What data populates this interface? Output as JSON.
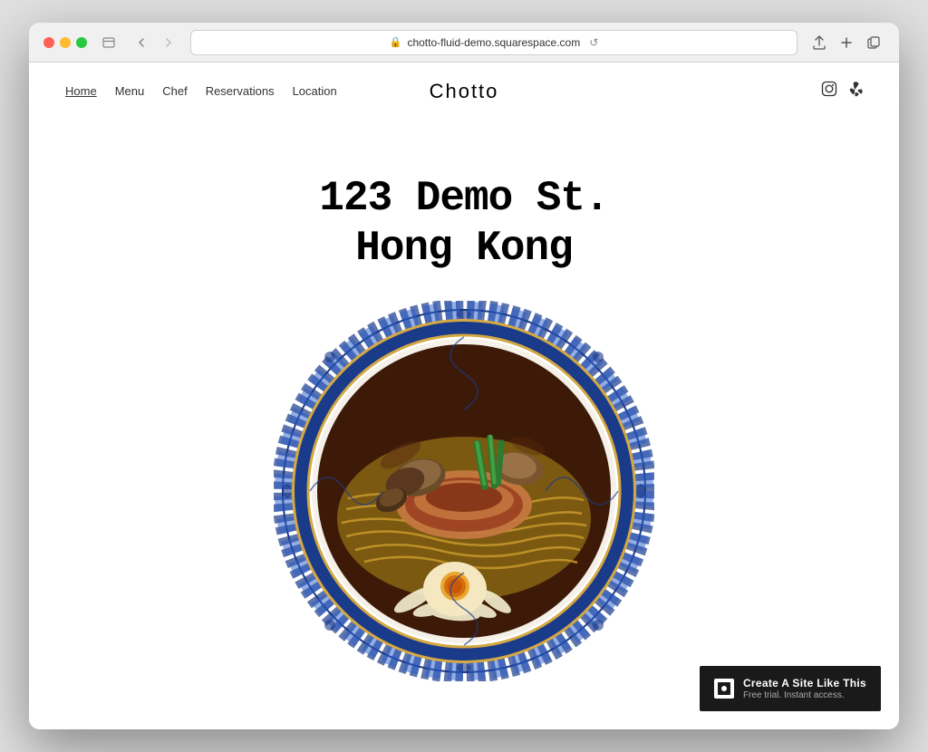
{
  "browser": {
    "url": "chotto-fluid-demo.squarespace.com",
    "back_label": "‹",
    "forward_label": "›",
    "refresh_label": "↺",
    "share_label": "⬆",
    "new_tab_label": "+",
    "duplicate_label": "⧉",
    "window_toggle_label": "❐"
  },
  "site": {
    "title": "Chotto",
    "nav": [
      {
        "label": "Home",
        "active": true
      },
      {
        "label": "Menu",
        "active": false
      },
      {
        "label": "Chef",
        "active": false
      },
      {
        "label": "Reservations",
        "active": false
      },
      {
        "label": "Location",
        "active": false
      }
    ],
    "social": [
      {
        "name": "instagram-icon",
        "glyph": "⬡"
      },
      {
        "name": "yelp-icon",
        "glyph": "❋"
      }
    ],
    "hero": {
      "line1": "123 Demo St.",
      "line2": "Hong Kong"
    },
    "banner": {
      "main_text": "Create A Site Like This",
      "sub_text": "Free trial. Instant access."
    }
  }
}
